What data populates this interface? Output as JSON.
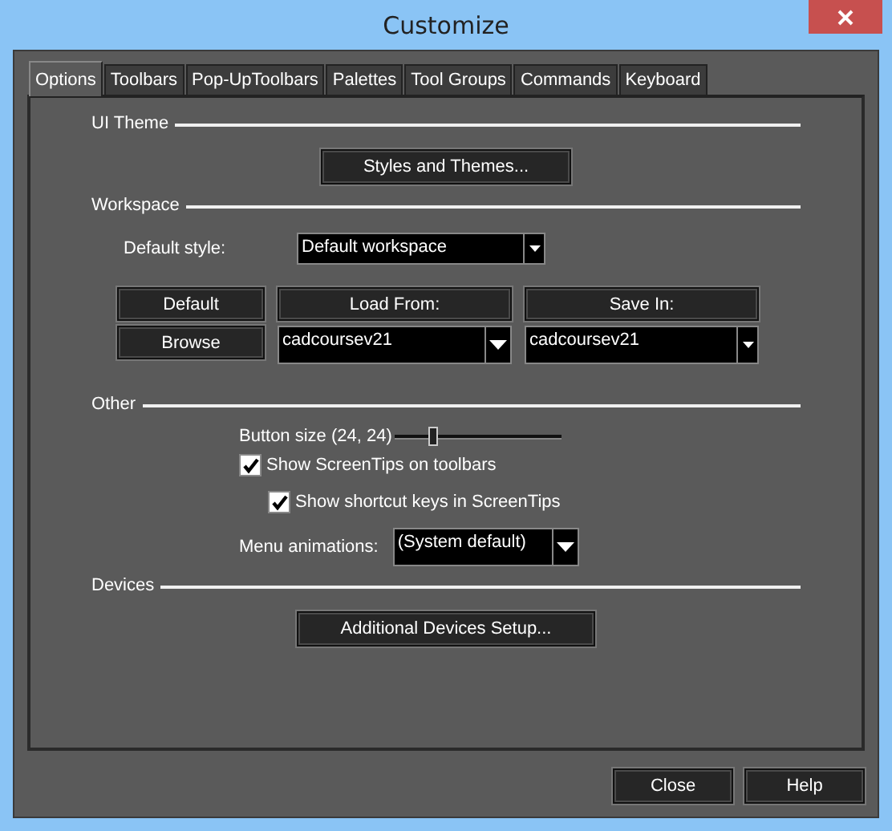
{
  "window": {
    "title": "Customize"
  },
  "tabs": [
    {
      "label": "Options",
      "selected": true
    },
    {
      "label": "Toolbars",
      "selected": false
    },
    {
      "label": "Pop-UpToolbars",
      "selected": false
    },
    {
      "label": "Palettes",
      "selected": false
    },
    {
      "label": "Tool Groups",
      "selected": false
    },
    {
      "label": "Commands",
      "selected": false
    },
    {
      "label": "Keyboard",
      "selected": false
    }
  ],
  "ui_theme": {
    "heading": "UI Theme",
    "button": "Styles and Themes..."
  },
  "workspace": {
    "heading": "Workspace",
    "default_style_label": "Default style:",
    "default_style_value": "Default workspace",
    "buttons": [
      "Default",
      "Load From:",
      "Save In:"
    ],
    "browse_button": "Browse",
    "load_from_value": "cadcoursev21",
    "save_in_value": "cadcoursev21"
  },
  "other": {
    "heading": "Other",
    "button_size_label": "Button size (24, 24)",
    "button_size": {
      "level": 0.2
    },
    "checkboxes": [
      {
        "label": "Show ScreenTips on toolbars",
        "checked": true,
        "kind": "main"
      },
      {
        "label": "Show shortcut keys in ScreenTips",
        "checked": true,
        "kind": "sub"
      }
    ],
    "menu_animations_label": "Menu animations:",
    "menu_animations_value": "(System default)"
  },
  "devices": {
    "heading": "Devices",
    "button": "Additional Devices Setup..."
  },
  "footer_buttons": [
    "Close",
    "Help"
  ]
}
